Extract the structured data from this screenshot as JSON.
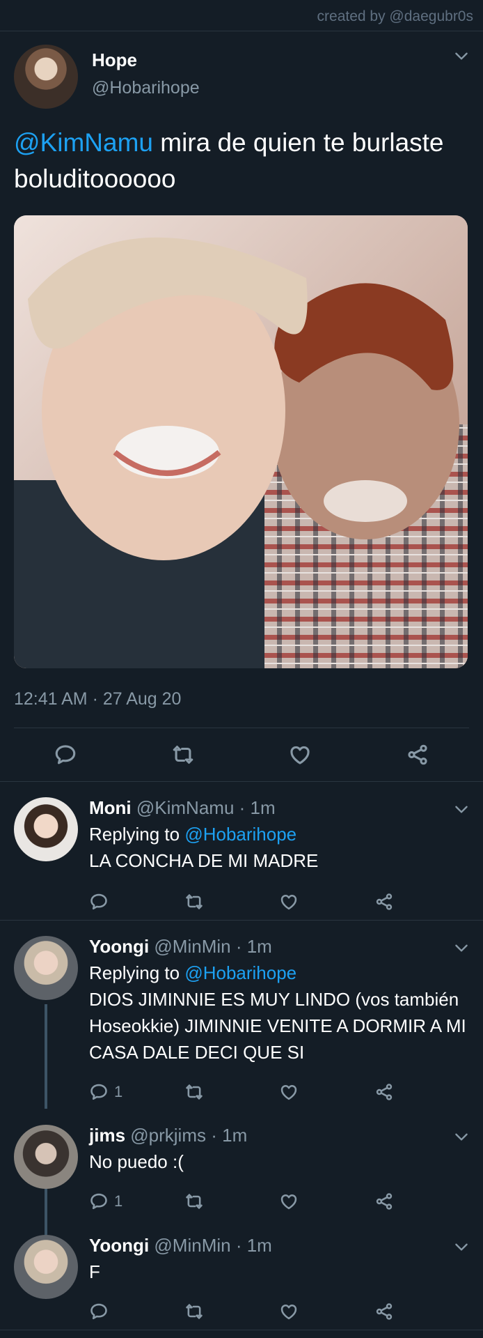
{
  "credit": "created by @daegubr0s",
  "tweet": {
    "display_name": "Hope",
    "handle": "@Hobarihope",
    "mention": "@KimNamu",
    "text": " mira de quien te burlaste boluditoooooo",
    "timestamp": "12:41 AM · 27 Aug 20"
  },
  "replies": [
    {
      "name": "Moni",
      "handle": "@KimNamu",
      "time": "· 1m",
      "replying_prefix": "Replying to",
      "replying_to": "@Hobarihope",
      "text": "LA CONCHA DE MI MADRE",
      "reply_count": ""
    },
    {
      "name": "Yoongi",
      "handle": "@MinMin",
      "time": "· 1m",
      "replying_prefix": "Replying to",
      "replying_to": "@Hobarihope",
      "text": "DIOS JIMINNIE ES MUY LINDO (vos también Hoseokkie) JIMINNIE VENITE A DORMIR A MI CASA DALE DECI QUE SI",
      "reply_count": "1"
    },
    {
      "name": "jims",
      "handle": "@prkjims",
      "time": "· 1m",
      "text": "No puedo :(",
      "reply_count": "1"
    },
    {
      "name": "Yoongi",
      "handle": "@MinMin",
      "time": "· 1m",
      "text": "F",
      "reply_count": ""
    }
  ],
  "colors": {
    "background": "#141d26",
    "accent": "#1da1f2",
    "secondary_text": "#8899a6"
  },
  "icons": [
    "chevron-down-icon",
    "reply-icon",
    "retweet-icon",
    "like-icon",
    "share-icon"
  ]
}
